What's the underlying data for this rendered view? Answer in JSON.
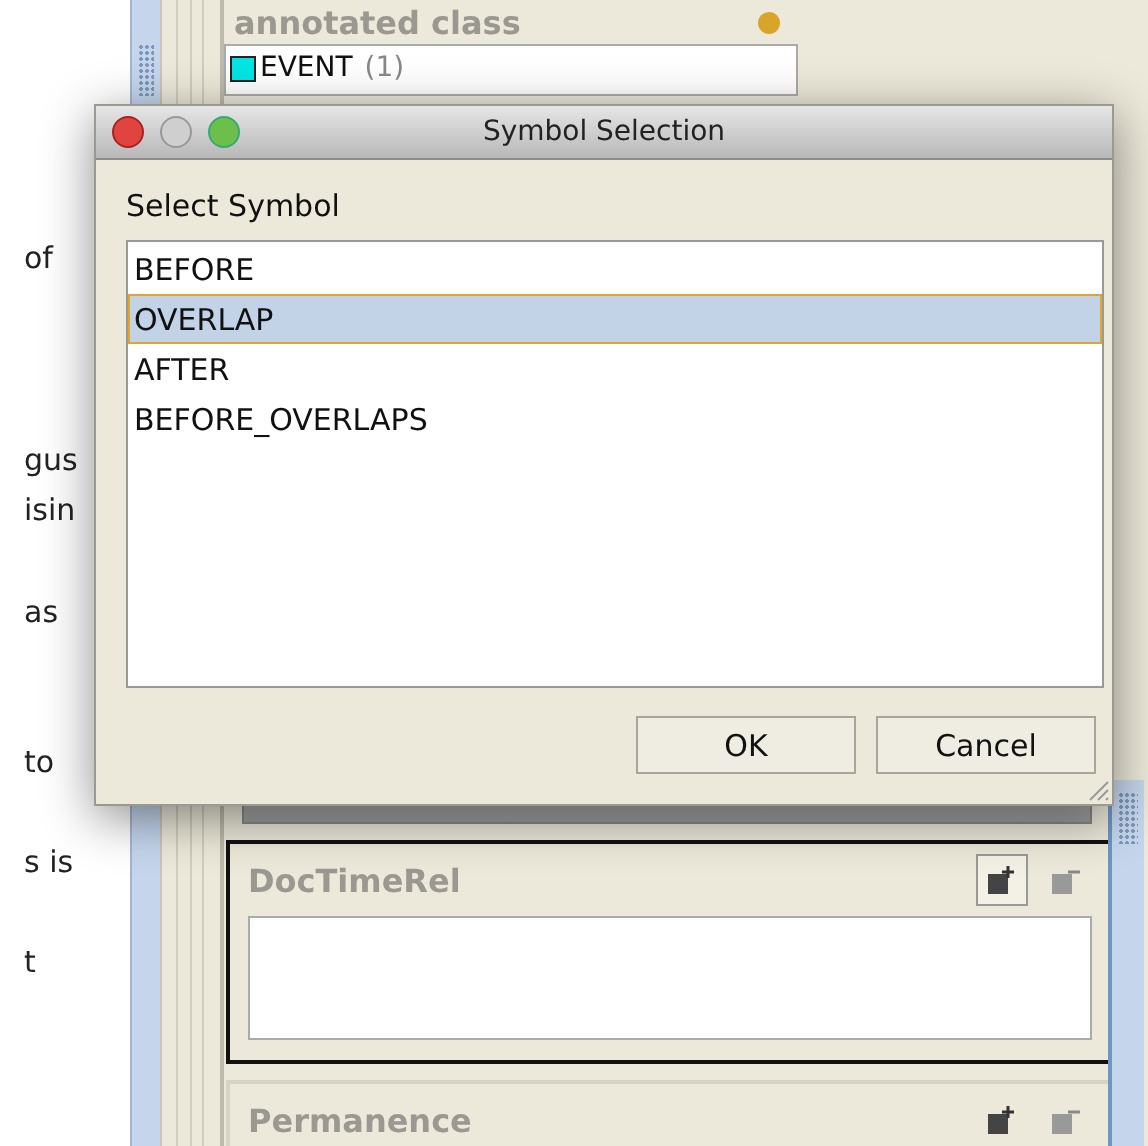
{
  "background_text": [
    "of",
    "gus",
    "isin",
    "as",
    "to",
    "s is",
    "t"
  ],
  "annotated_class": {
    "title": "annotated class",
    "items": [
      {
        "label": "EVENT",
        "count": "(1)",
        "color": "#00e5e5"
      }
    ]
  },
  "panels": [
    {
      "title": "DocTimeRel",
      "focused": true,
      "add_highlighted": true
    },
    {
      "title": "Permanence",
      "focused": false,
      "add_highlighted": false
    }
  ],
  "dialog": {
    "title": "Symbol Selection",
    "label": "Select Symbol",
    "options": [
      {
        "label": "BEFORE",
        "selected": false
      },
      {
        "label": "OVERLAP",
        "selected": true
      },
      {
        "label": "AFTER",
        "selected": false
      },
      {
        "label": "BEFORE_OVERLAPS",
        "selected": false
      }
    ],
    "buttons": [
      "OK",
      "Cancel"
    ]
  }
}
